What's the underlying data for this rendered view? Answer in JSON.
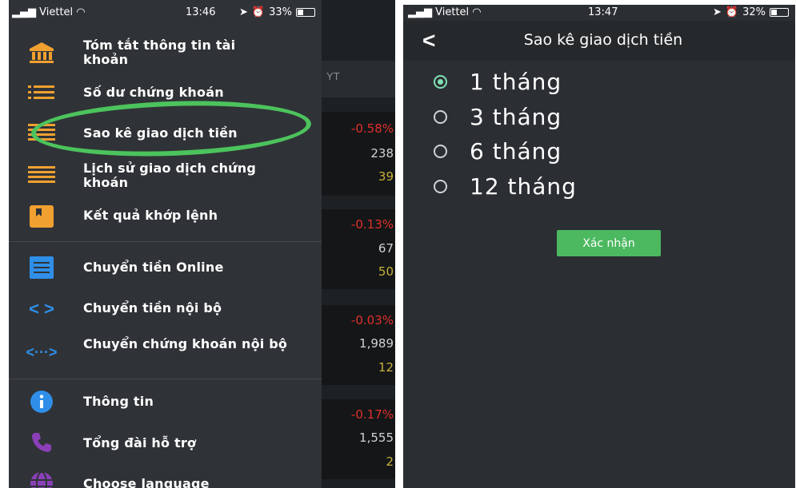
{
  "left": {
    "status": {
      "carrier": "Viettel",
      "time": "13:46",
      "battery": "33%"
    },
    "background": {
      "header": "YT",
      "values": [
        "-0.58%",
        "238",
        "39",
        "-0.13%",
        "67",
        "50",
        "-0.03%",
        "1,989",
        "12",
        "-0.17%",
        "1,555",
        "2"
      ]
    },
    "menu": [
      {
        "label": "Tóm tắt thông tin tài khoản",
        "icon": "bank-icon"
      },
      {
        "label": "Số dư chứng khoán",
        "icon": "list-icon"
      },
      {
        "label": "Sao kê giao dịch tiền",
        "icon": "lines-icon"
      },
      {
        "label": "Lịch sử giao dịch chứng khoán",
        "icon": "lines-icon"
      },
      {
        "label": "Kết quả khớp lệnh",
        "icon": "bookmark-icon"
      },
      {
        "label": "Chuyển tiền Online",
        "icon": "receipt-icon"
      },
      {
        "label": "Chuyển tiền nội bộ",
        "icon": "code-arrows-icon"
      },
      {
        "label": "Chuyển chứng khoán nội bộ",
        "icon": "transfer-arrows-icon"
      },
      {
        "label": "Thông tin",
        "icon": "info-icon"
      },
      {
        "label": "Tổng đài hỗ trợ",
        "icon": "phone-icon"
      },
      {
        "label": "Choose language",
        "icon": "globe-icon"
      }
    ]
  },
  "right": {
    "status": {
      "carrier": "Viettel",
      "time": "13:47",
      "battery": "32%"
    },
    "title": "Sao kê giao dịch tiền",
    "options": [
      "1 tháng",
      "3 tháng",
      "6 tháng",
      "12 tháng"
    ],
    "selected_index": 0,
    "confirm_label": "Xác nhận"
  },
  "colors": {
    "accent_green": "#4cb860",
    "ellipse_green": "#4cc35c",
    "radio_selected": "#7fe0b3",
    "icon_orange": "#f0a030",
    "icon_blue": "#2f8fe8",
    "icon_purple": "#8a3fb8"
  }
}
